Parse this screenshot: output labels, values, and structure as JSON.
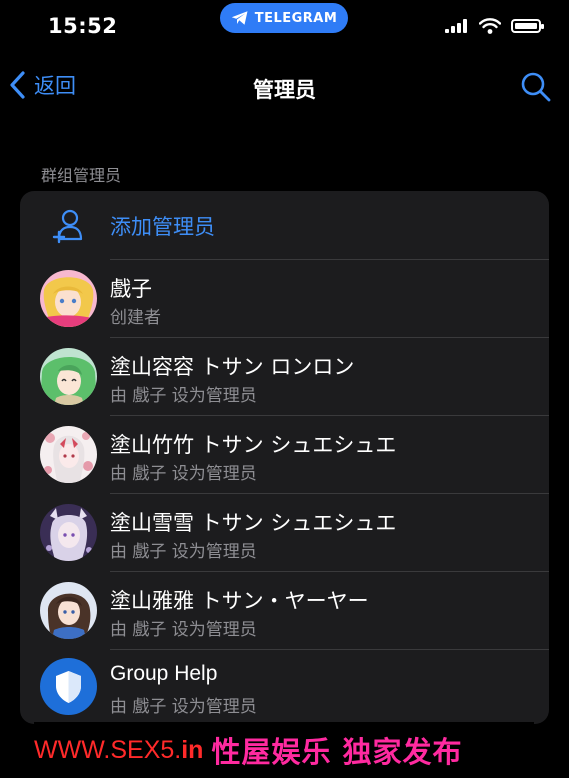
{
  "status": {
    "time": "15:52",
    "telegram_label": "TELEGRAM"
  },
  "nav": {
    "back_label": "返回",
    "title": "管理员"
  },
  "section": {
    "header": "群组管理员"
  },
  "add_admin": {
    "label": "添加管理员"
  },
  "admins": [
    {
      "name": "戲子",
      "role": "创建者"
    },
    {
      "name": "塗山容容 トサン ロンロン",
      "role": "由 戲子 设为管理员"
    },
    {
      "name": "塗山竹竹 トサン シュエシュエ",
      "role": "由 戲子 设为管理员"
    },
    {
      "name": "塗山雪雪 トサン シュエシュエ",
      "role": "由 戲子 设为管理员"
    },
    {
      "name": "塗山雅雅 トサン・ヤーヤー",
      "role": "由 戲子 设为管理员"
    },
    {
      "name": "Group Help",
      "role": "由 戲子 设为管理员"
    }
  ],
  "watermark": {
    "url_prefix": "WWW.SEX5.",
    "url_suffix": "in",
    "text": "性屋娱乐 独家发布"
  },
  "colors": {
    "accent": "#3e8ef7",
    "background": "#000000",
    "card": "#1c1c1e",
    "secondary_text": "#8e8e93",
    "watermark_pink": "#ff2aa0",
    "watermark_red": "#ff2a2a"
  }
}
